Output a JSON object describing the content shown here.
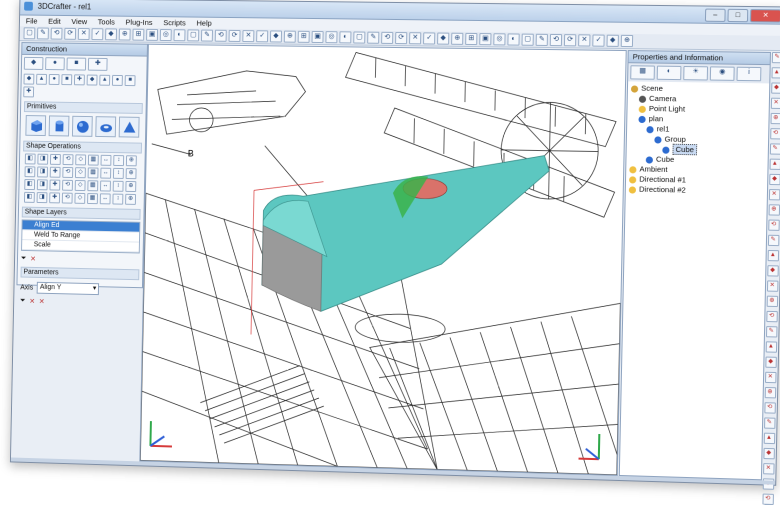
{
  "window": {
    "title": "3DCrafter - rel1"
  },
  "menu": [
    "File",
    "Edit",
    "View",
    "Tools",
    "Plug-Ins",
    "Scripts",
    "Help"
  ],
  "left_panel": {
    "header": "Construction",
    "primitives_title": "Primitives",
    "shape_ops_title": "Shape Operations",
    "shape_layers_title": "Shape Layers",
    "layers": [
      "Align Ed",
      "Weld To Range",
      "Scale"
    ],
    "parameters_title": "Parameters",
    "axis_label": "Axis",
    "axis_value": "Align Y"
  },
  "right_panel": {
    "header": "Properties and Information",
    "tree": [
      {
        "label": "Scene",
        "level": 0,
        "icon": "folder"
      },
      {
        "label": "Camera",
        "level": 1,
        "icon": "camera"
      },
      {
        "label": "Point Light",
        "level": 1,
        "icon": "light"
      },
      {
        "label": "plan",
        "level": 1,
        "icon": "object"
      },
      {
        "label": "rel1",
        "level": 2,
        "icon": "object"
      },
      {
        "label": "Group",
        "level": 3,
        "icon": "object"
      },
      {
        "label": "Cube",
        "level": 4,
        "icon": "cube",
        "selected": true
      },
      {
        "label": "Cube",
        "level": 2,
        "icon": "cube"
      },
      {
        "label": "Ambient",
        "level": 0,
        "icon": "light"
      },
      {
        "label": "Directional #1",
        "level": 0,
        "icon": "light"
      },
      {
        "label": "Directional #2",
        "level": 0,
        "icon": "light"
      }
    ]
  },
  "colors": {
    "selection": "#3b7fd1",
    "model_teal": "#5cc7c0",
    "model_red": "#d9726a",
    "model_green": "#39b34a",
    "axis_red": "#d63a3a",
    "axis_green": "#2fa84a",
    "axis_blue": "#2f5fd6"
  }
}
